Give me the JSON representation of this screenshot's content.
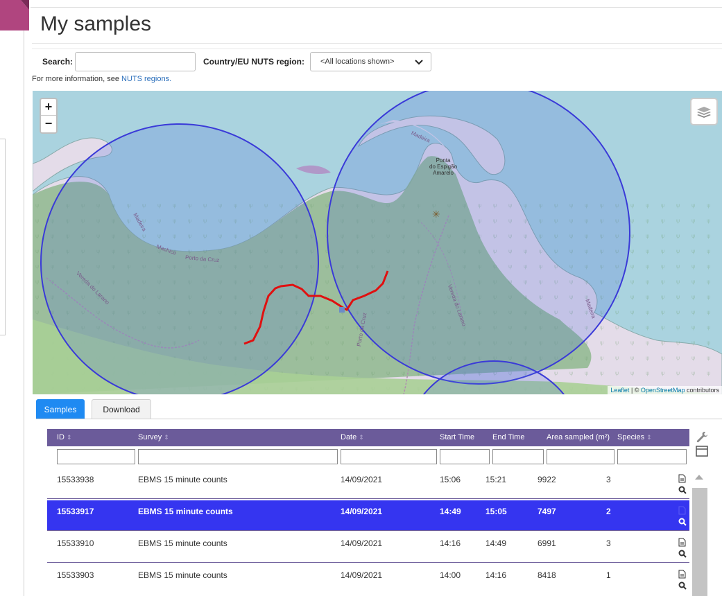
{
  "page": {
    "title": "My samples"
  },
  "filters": {
    "search_label": "Search:",
    "search_value": "",
    "region_label": "Country/EU NUTS region:",
    "region_selected": "<All locations shown>",
    "info_prefix": "For more information, see ",
    "info_link": "NUTS regions."
  },
  "map": {
    "zoom_in": "+",
    "zoom_out": "−",
    "labels": {
      "point": "Ponta\ndo Espigão\nAmarelo",
      "machico": "Machico",
      "porto_cruz": "Porto da Cruz",
      "vereda": "Vereda do Larano",
      "vereda2": "Vereda do Larano",
      "madeira": "Madeira",
      "madeira2": "Madeira",
      "madeira3": "Madeira",
      "porto_cruz2": "Porto da Cruz"
    },
    "attribution_leaflet": "Leaflet",
    "attribution_sep": " | © ",
    "attribution_osm": "OpenStreetMap",
    "attribution_suffix": " contributors",
    "colors": {
      "sea": "#aad3df",
      "land": "#e4dce9",
      "forest": "#8fb98e",
      "circle": "#3a3ad8",
      "track": "#e01010"
    }
  },
  "tabs": [
    {
      "label": "Samples",
      "active": true
    },
    {
      "label": "Download",
      "active": false
    }
  ],
  "table": {
    "columns": [
      "ID",
      "Survey",
      "Date",
      "Start Time",
      "End Time",
      "Area sampled (m²)",
      "Species"
    ],
    "rows": [
      {
        "id": "15533938",
        "survey": "EBMS 15 minute counts",
        "date": "14/09/2021",
        "start": "15:06",
        "end": "15:21",
        "area": "9922",
        "species": "3",
        "selected": false
      },
      {
        "id": "15533917",
        "survey": "EBMS 15 minute counts",
        "date": "14/09/2021",
        "start": "14:49",
        "end": "15:05",
        "area": "7497",
        "species": "2",
        "selected": true
      },
      {
        "id": "15533910",
        "survey": "EBMS 15 minute counts",
        "date": "14/09/2021",
        "start": "14:16",
        "end": "14:49",
        "area": "6991",
        "species": "3",
        "selected": false
      },
      {
        "id": "15533903",
        "survey": "EBMS 15 minute counts",
        "date": "14/09/2021",
        "start": "14:00",
        "end": "14:16",
        "area": "8418",
        "species": "1",
        "selected": false
      }
    ],
    "header_color": "#6b5b9a",
    "selected_color": "#3535f0"
  },
  "icons": [
    "layers-icon",
    "zoom-in-icon",
    "zoom-out-icon",
    "chevron-down-icon",
    "document-icon",
    "magnifier-icon",
    "wrench-icon",
    "column-toggle-icon",
    "sort-icon"
  ]
}
